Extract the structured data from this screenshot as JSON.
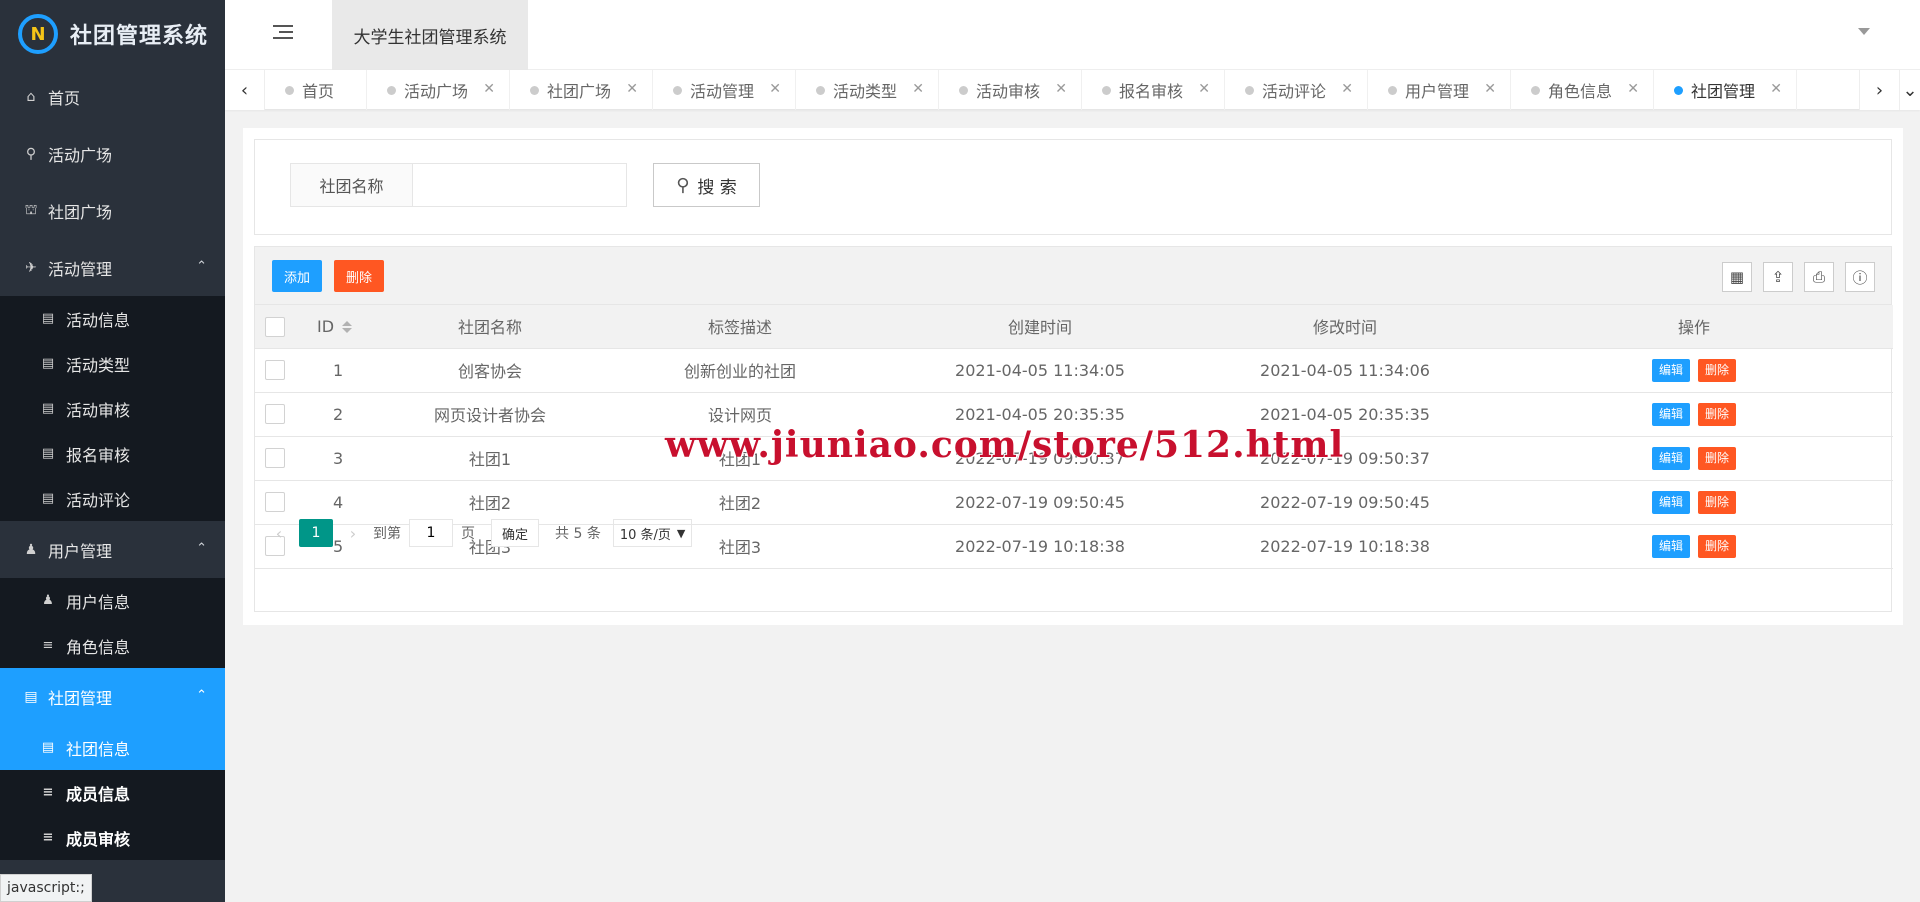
{
  "app": {
    "title": "社团管理系统",
    "site_title": "大学生社团管理系统",
    "status_link": "javascript:;"
  },
  "sidebar": {
    "items": [
      {
        "label": "首页",
        "icon": "home-icon",
        "glyph": "⌂"
      },
      {
        "label": "活动广场",
        "icon": "bicycle-icon",
        "glyph": "⚲"
      },
      {
        "label": "社团广场",
        "icon": "bank-icon",
        "glyph": "⛫"
      },
      {
        "label": "活动管理",
        "icon": "paper-plane-icon",
        "glyph": "✈",
        "expanded": true,
        "children": [
          "活动信息",
          "活动类型",
          "活动审核",
          "报名审核",
          "活动评论"
        ]
      },
      {
        "label": "用户管理",
        "icon": "users-icon",
        "glyph": "♟",
        "expanded": true,
        "children": [
          "用户信息",
          "角色信息"
        ]
      },
      {
        "label": "社团管理",
        "icon": "book-icon",
        "glyph": "▤",
        "expanded": true,
        "active": true,
        "children": [
          "社团信息",
          "成员信息",
          "成员审核"
        ]
      }
    ]
  },
  "tabs": [
    "首页",
    "活动广场",
    "社团广场",
    "活动管理",
    "活动类型",
    "活动审核",
    "报名审核",
    "活动评论",
    "用户管理",
    "角色信息",
    "社团管理"
  ],
  "search": {
    "label": "社团名称",
    "value": "",
    "placeholder": "",
    "button": "搜 索"
  },
  "toolbar": {
    "add": "添加",
    "delete": "删除"
  },
  "table": {
    "columns": [
      "ID",
      "社团名称",
      "标签描述",
      "创建时间",
      "修改时间",
      "操作"
    ],
    "rows": [
      {
        "id": "1",
        "name": "创客协会",
        "desc": "创新创业的社团",
        "created": "2021-04-05 11:34:05",
        "modified": "2021-04-05 11:34:06"
      },
      {
        "id": "2",
        "name": "网页设计者协会",
        "desc": "设计网页",
        "created": "2021-04-05 20:35:35",
        "modified": "2021-04-05 20:35:35"
      },
      {
        "id": "3",
        "name": "社团1",
        "desc": "社团1",
        "created": "2022-07-19 09:50:37",
        "modified": "2022-07-19 09:50:37"
      },
      {
        "id": "4",
        "name": "社团2",
        "desc": "社团2",
        "created": "2022-07-19 09:50:45",
        "modified": "2022-07-19 09:50:45"
      },
      {
        "id": "5",
        "name": "社团3",
        "desc": "社团3",
        "created": "2022-07-19 10:18:38",
        "modified": "2022-07-19 10:18:38"
      }
    ],
    "edit_label": "编辑",
    "delete_label": "删除"
  },
  "pager": {
    "current": "1",
    "goto_prefix": "到第",
    "goto_value": "1",
    "goto_suffix": "页",
    "confirm": "确定",
    "total": "共 5 条",
    "page_size": "10 条/页"
  },
  "watermark": "www.jiuniao.com/store/512.html",
  "colors": {
    "primary": "#1e9fff",
    "danger": "#ff5722",
    "pager": "#009688",
    "sidebar": "#2a313b"
  }
}
